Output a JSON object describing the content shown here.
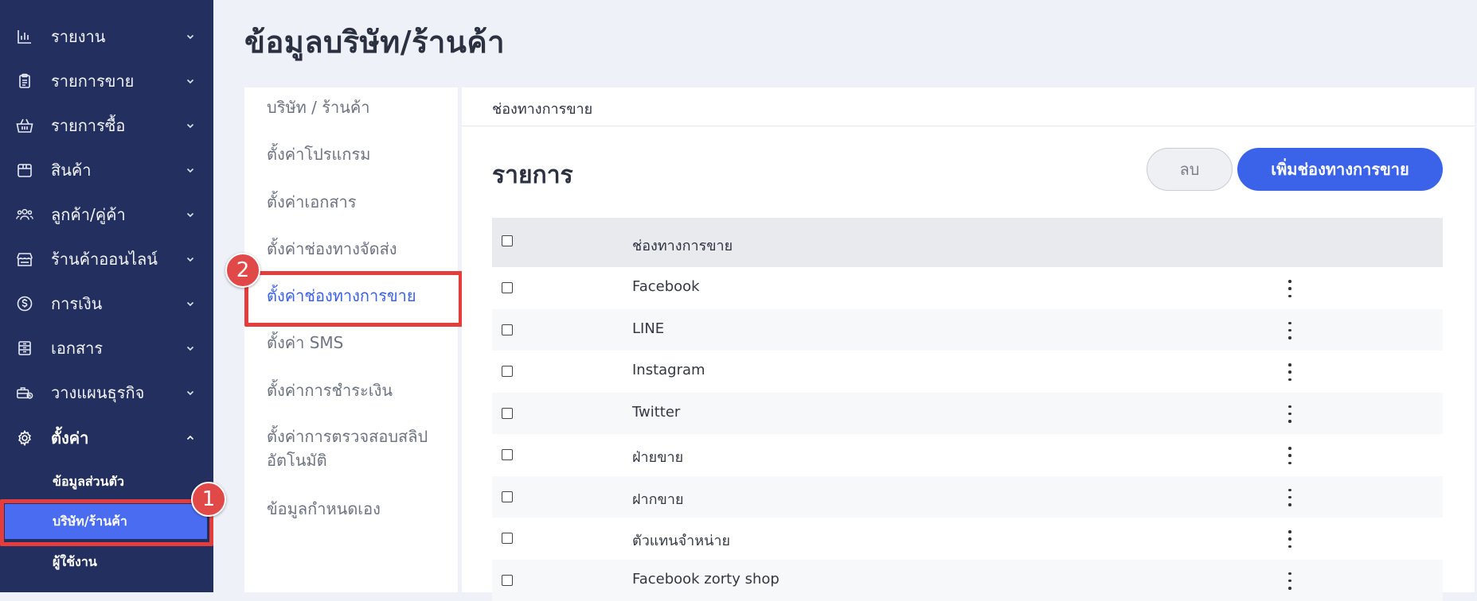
{
  "sidebar": {
    "items": [
      {
        "label": "รายงาน",
        "icon": "bar-chart-icon"
      },
      {
        "label": "รายการขาย",
        "icon": "clipboard-icon"
      },
      {
        "label": "รายการซื้อ",
        "icon": "basket-icon"
      },
      {
        "label": "สินค้า",
        "icon": "box-icon"
      },
      {
        "label": "ลูกค้า/คู่ค้า",
        "icon": "users-icon"
      },
      {
        "label": "ร้านค้าออนไลน์",
        "icon": "store-icon"
      },
      {
        "label": "การเงิน",
        "icon": "dollar-icon"
      },
      {
        "label": "เอกสาร",
        "icon": "document-icon"
      },
      {
        "label": "วางแผนธุรกิจ",
        "icon": "briefcase-icon"
      },
      {
        "label": "ตั้งค่า",
        "icon": "gear-icon"
      }
    ],
    "sub_items": [
      {
        "label": "ข้อมูลส่วนตัว"
      },
      {
        "label": "บริษัท/ร้านค้า"
      },
      {
        "label": "ผู้ใช้งาน"
      }
    ]
  },
  "annotations": {
    "badge1": "1",
    "badge2": "2"
  },
  "page": {
    "title": "ข้อมูลบริษัท/ร้านค้า"
  },
  "settings_menu": {
    "items": [
      {
        "label": "บริษัท / ร้านค้า"
      },
      {
        "label": "ตั้งค่าโปรแกรม"
      },
      {
        "label": "ตั้งค่าเอกสาร"
      },
      {
        "label": "ตั้งค่าช่องทางจัดส่ง"
      },
      {
        "label": "ตั้งค่าช่องทางการขาย"
      },
      {
        "label": "ตั้งค่า SMS"
      },
      {
        "label": "ตั้งค่าการชำระเงิน"
      },
      {
        "label": "ตั้งค่าการตรวจสอบสลิปอัตโนมัติ"
      },
      {
        "label": "ข้อมูลกำหนดเอง"
      }
    ]
  },
  "main": {
    "header": "ช่องทางการขาย",
    "list_title": "รายการ",
    "delete_label": "ลบ",
    "add_label": "เพิ่มช่องทางการขาย",
    "table": {
      "column": "ช่องทางการขาย",
      "rows": [
        {
          "name": "Facebook"
        },
        {
          "name": "LINE"
        },
        {
          "name": "Instagram"
        },
        {
          "name": "Twitter"
        },
        {
          "name": "ฝ่ายขาย"
        },
        {
          "name": "ฝากขาย"
        },
        {
          "name": "ตัวแทนจำหน่าย"
        },
        {
          "name": "Facebook zorty shop"
        }
      ]
    }
  },
  "colors": {
    "sidebar": "#232f5e",
    "accent": "#3a63ea",
    "highlight": "#e53d3d"
  }
}
